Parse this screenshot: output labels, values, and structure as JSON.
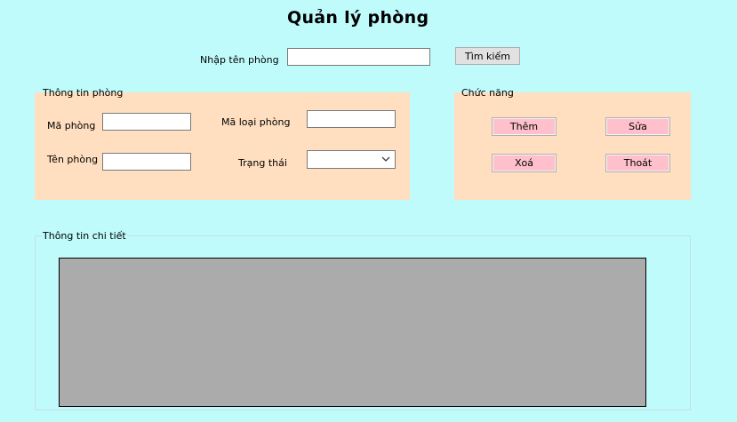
{
  "window": {
    "title": "Quản lý phòng"
  },
  "search": {
    "label": "Nhập tên phòng",
    "value": "",
    "button_label": "Tìm kiếm"
  },
  "room_info": {
    "caption": "Thông tin phòng",
    "room_id_label": "Mã phòng",
    "room_id_value": "",
    "room_name_label": "Tên phòng",
    "room_name_value": "",
    "room_type_label": "Mã loại phòng",
    "room_type_value": "",
    "status_label": "Trạng thái",
    "status_value": ""
  },
  "functions": {
    "caption": "Chức năng",
    "add_label": "Thêm",
    "edit_label": "Sửa",
    "delete_label": "Xoá",
    "exit_label": "Thoát"
  },
  "details": {
    "caption": "Thông tin chi tiết"
  },
  "icons": {
    "status_dropdown": "chevron-down-icon"
  },
  "colors": {
    "background": "#c0fbfc",
    "groupbox": "#ffdfc0",
    "action_button": "#ffc0cb",
    "grid": "#ababab"
  }
}
